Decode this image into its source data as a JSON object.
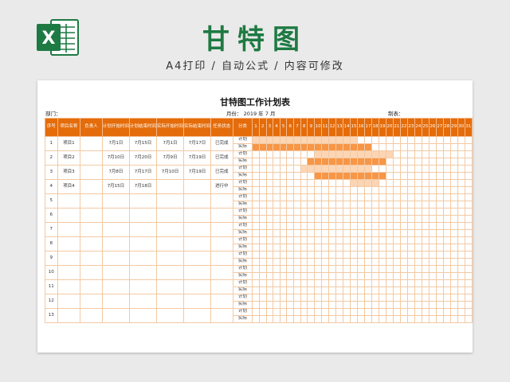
{
  "banner": {
    "title": "甘特图",
    "subtitle": "A4打印 / 自动公式 / 内容可修改",
    "logo_letter": "X",
    "brand_color": "#1e7a43"
  },
  "sheet": {
    "title": "甘特图工作计划表",
    "dept_label": "部门：",
    "month_text": "月份： 2019  年  7  月",
    "maker_label": "制表："
  },
  "table": {
    "headers": {
      "index": "序号",
      "name": "项目名称",
      "owner": "负责人",
      "plan_start": "计划开始时间",
      "plan_end": "计划结束时间",
      "actual_start": "实际开始时间",
      "actual_end": "实际结束时间",
      "status": "任务状态",
      "category": "分类"
    },
    "days": [
      "1",
      "2",
      "3",
      "4",
      "5",
      "6",
      "7",
      "8",
      "9",
      "10",
      "11",
      "12",
      "13",
      "14",
      "15",
      "16",
      "17",
      "18",
      "19",
      "20",
      "21",
      "22",
      "23",
      "24",
      "25",
      "26",
      "27",
      "28",
      "29",
      "30",
      "31"
    ],
    "row_labels": {
      "plan": "计划",
      "actual": "实际"
    },
    "colors": {
      "header": "#e46c0a",
      "plan_bar": "#fcd5b4",
      "actual_bar": "#f79646",
      "border": "#f3c9a3"
    },
    "rows": [
      {
        "index": "1",
        "name": "项目1",
        "owner": "",
        "plan_start": "7月1日",
        "plan_end": "7月15日",
        "actual_start": "7月1日",
        "actual_end": "7月17日",
        "status": "已完成",
        "plan_range": [
          1,
          15
        ],
        "actual_range": [
          1,
          17
        ]
      },
      {
        "index": "2",
        "name": "项目2",
        "owner": "",
        "plan_start": "7月10日",
        "plan_end": "7月20日",
        "actual_start": "7月9日",
        "actual_end": "7月19日",
        "status": "已完成",
        "plan_range": [
          10,
          20
        ],
        "actual_range": [
          9,
          19
        ]
      },
      {
        "index": "3",
        "name": "项目3",
        "owner": "",
        "plan_start": "7月8日",
        "plan_end": "7月17日",
        "actual_start": "7月10日",
        "actual_end": "7月19日",
        "status": "已完成",
        "plan_range": [
          8,
          17
        ],
        "actual_range": [
          10,
          19
        ]
      },
      {
        "index": "4",
        "name": "项目4",
        "owner": "",
        "plan_start": "7月15日",
        "plan_end": "7月18日",
        "actual_start": "",
        "actual_end": "",
        "status": "进行中",
        "plan_range": [
          15,
          18
        ],
        "actual_range": null
      },
      {
        "index": "5",
        "name": "",
        "owner": "",
        "plan_start": "",
        "plan_end": "",
        "actual_start": "",
        "actual_end": "",
        "status": "",
        "plan_range": null,
        "actual_range": null
      },
      {
        "index": "6",
        "name": "",
        "owner": "",
        "plan_start": "",
        "plan_end": "",
        "actual_start": "",
        "actual_end": "",
        "status": "",
        "plan_range": null,
        "actual_range": null
      },
      {
        "index": "7",
        "name": "",
        "owner": "",
        "plan_start": "",
        "plan_end": "",
        "actual_start": "",
        "actual_end": "",
        "status": "",
        "plan_range": null,
        "actual_range": null
      },
      {
        "index": "8",
        "name": "",
        "owner": "",
        "plan_start": "",
        "plan_end": "",
        "actual_start": "",
        "actual_end": "",
        "status": "",
        "plan_range": null,
        "actual_range": null
      },
      {
        "index": "9",
        "name": "",
        "owner": "",
        "plan_start": "",
        "plan_end": "",
        "actual_start": "",
        "actual_end": "",
        "status": "",
        "plan_range": null,
        "actual_range": null
      },
      {
        "index": "10",
        "name": "",
        "owner": "",
        "plan_start": "",
        "plan_end": "",
        "actual_start": "",
        "actual_end": "",
        "status": "",
        "plan_range": null,
        "actual_range": null
      },
      {
        "index": "11",
        "name": "",
        "owner": "",
        "plan_start": "",
        "plan_end": "",
        "actual_start": "",
        "actual_end": "",
        "status": "",
        "plan_range": null,
        "actual_range": null
      },
      {
        "index": "12",
        "name": "",
        "owner": "",
        "plan_start": "",
        "plan_end": "",
        "actual_start": "",
        "actual_end": "",
        "status": "",
        "plan_range": null,
        "actual_range": null
      },
      {
        "index": "13",
        "name": "",
        "owner": "",
        "plan_start": "",
        "plan_end": "",
        "actual_start": "",
        "actual_end": "",
        "status": "",
        "plan_range": null,
        "actual_range": null
      }
    ]
  }
}
